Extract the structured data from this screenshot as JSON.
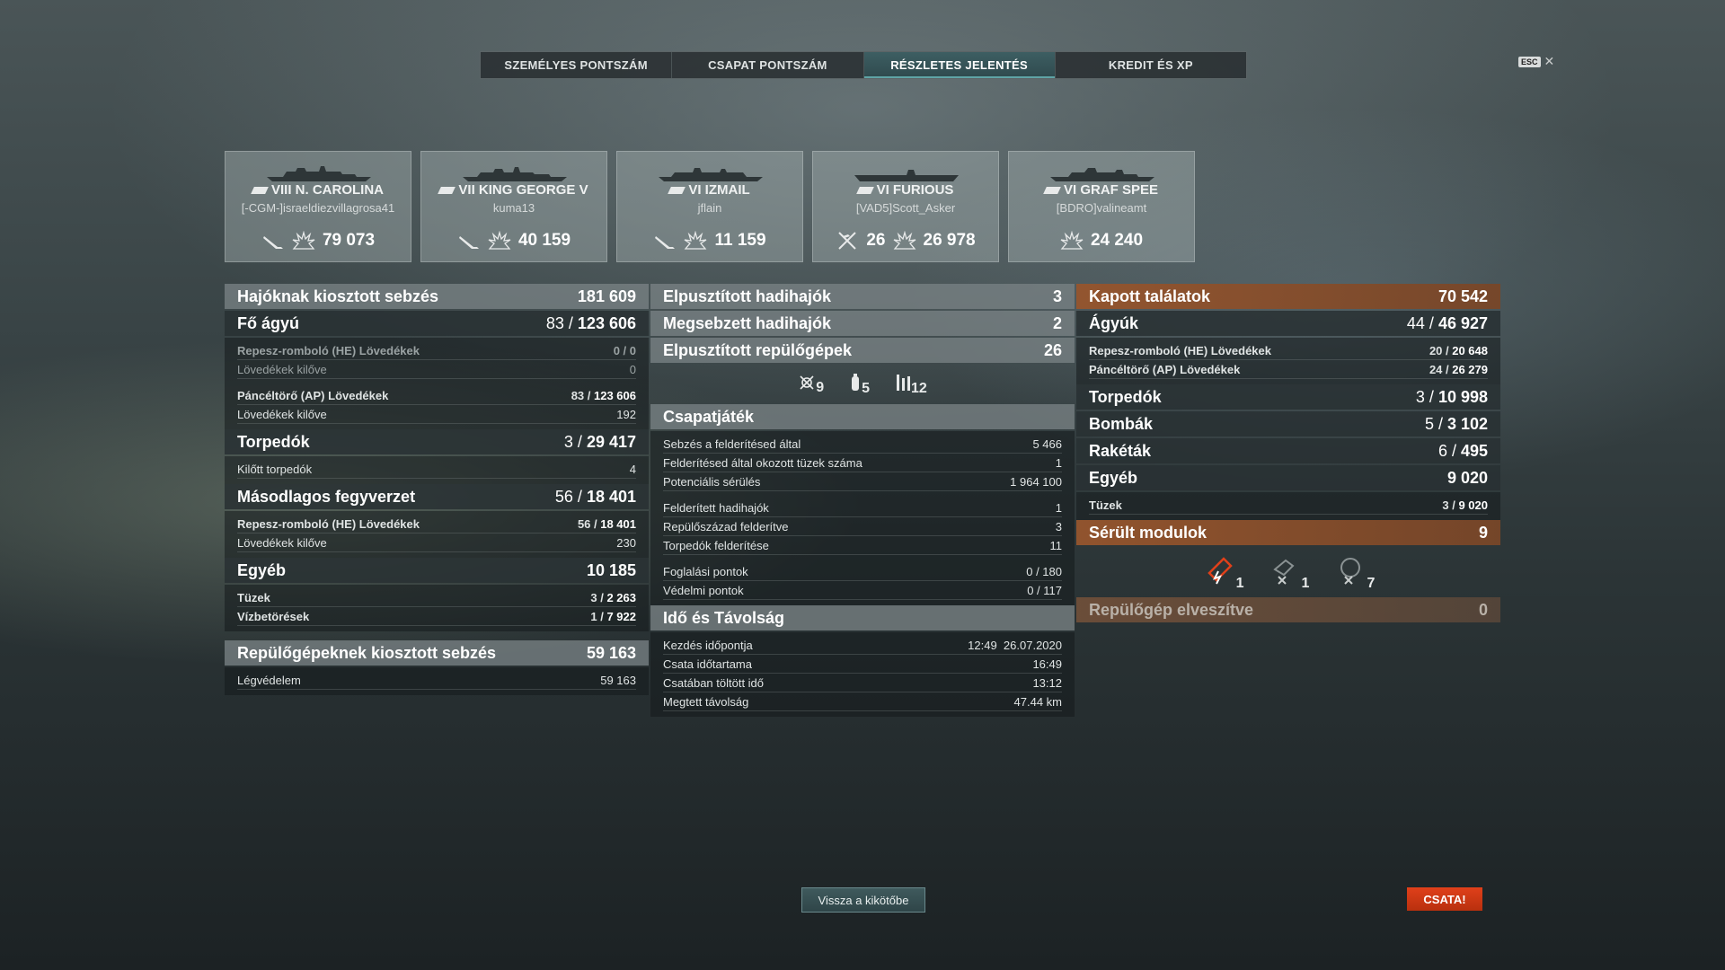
{
  "tabs": [
    "SZEMÉLYES PONTSZÁM",
    "CSAPAT PONTSZÁM",
    "RÉSZLETES JELENTÉS",
    "KREDIT ÉS XP"
  ],
  "esc": {
    "key": "ESC",
    "close": "✕"
  },
  "ships": [
    {
      "name": "VIII N. CAROLINA",
      "player": "[-CGM-]israeldiezvillagrosa41",
      "stats": [
        {
          "icon": "torpedo-hit-icon",
          "value": ""
        },
        {
          "icon": "damage-splash-icon",
          "value": "79 073"
        }
      ]
    },
    {
      "name": "VII KING GEORGE V",
      "player": "kuma13",
      "stats": [
        {
          "icon": "torpedo-hit-icon",
          "value": ""
        },
        {
          "icon": "damage-splash-icon",
          "value": "40 159"
        }
      ]
    },
    {
      "name": "VI IZMAIL",
      "player": "jflain",
      "stats": [
        {
          "icon": "torpedo-hit-icon",
          "value": ""
        },
        {
          "icon": "damage-splash-icon",
          "value": "11 159"
        }
      ]
    },
    {
      "name": "VI FURIOUS",
      "player": "[VAD5]Scott_Asker",
      "stats": [
        {
          "icon": "plane-shot-icon",
          "value": "26"
        },
        {
          "icon": "damage-splash-icon",
          "value": "26 978"
        }
      ]
    },
    {
      "name": "VI GRAF SPEE",
      "player": "[BDRO]valineamt",
      "stats": [
        {
          "icon": "damage-splash-icon",
          "value": "24 240"
        }
      ]
    }
  ],
  "left": {
    "ship_damage": {
      "label": "Hajóknak kiosztott sebzés",
      "value": "181 609"
    },
    "main": {
      "label": "Fő ágyú",
      "hits": "83 / ",
      "dmg": "123 606"
    },
    "he": {
      "label": "Repesz-romboló (HE) Lövedékek",
      "value": "0 / 0"
    },
    "he_fired": {
      "label": "Lövedékek kilőve",
      "value": "0"
    },
    "ap": {
      "label": "Páncéltörő (AP) Lövedékek",
      "hits": "83 / ",
      "dmg": "123 606"
    },
    "ap_fired": {
      "label": "Lövedékek kilőve",
      "value": "192"
    },
    "torp": {
      "label": "Torpedók",
      "hits": "3 / ",
      "dmg": "29 417"
    },
    "torp_fired": {
      "label": "Kilőtt torpedók",
      "value": "4"
    },
    "sec": {
      "label": "Másodlagos fegyverzet",
      "hits": "56 / ",
      "dmg": "18 401"
    },
    "sec_he": {
      "label": "Repesz-romboló (HE) Lövedékek",
      "hits": "56 / ",
      "dmg": "18 401"
    },
    "sec_fired": {
      "label": "Lövedékek kilőve",
      "value": "230"
    },
    "other": {
      "label": "Egyéb",
      "value": "10 185"
    },
    "fires": {
      "label": "Tüzek",
      "hits": "3 / ",
      "dmg": "2 263"
    },
    "flood": {
      "label": "Vízbetörések",
      "hits": "1 / ",
      "dmg": "7 922"
    },
    "plane_damage": {
      "label": "Repülőgépeknek kiosztott sebzés",
      "value": "59 163"
    },
    "aa": {
      "label": "Légvédelem",
      "value": "59 163"
    }
  },
  "mid": {
    "destroyed": {
      "label": "Elpusztított hadihajók",
      "value": "3"
    },
    "damaged": {
      "label": "Megsebzett hadihajók",
      "value": "2"
    },
    "planes": {
      "label": "Elpusztított repülőgépek",
      "value": "26"
    },
    "plane_types": [
      {
        "icon": "fighter-icon",
        "value": "9"
      },
      {
        "icon": "bomber-icon",
        "value": "5"
      },
      {
        "icon": "rocket-plane-icon",
        "value": "12"
      }
    ],
    "team": {
      "label": "Csapatjáték"
    },
    "spot_dmg": {
      "label": "Sebzés a felderítésed által",
      "value": "5 466"
    },
    "spot_fires": {
      "label": "Felderítésed által okozott tüzek száma",
      "value": "1"
    },
    "potential": {
      "label": "Potenciális sérülés",
      "value": "1 964 100"
    },
    "spotted_ships": {
      "label": "Felderített hadihajók",
      "value": "1"
    },
    "spotted_squad": {
      "label": "Repülőszázad felderítve",
      "value": "3"
    },
    "spotted_torp": {
      "label": "Torpedók felderítése",
      "value": "11"
    },
    "capture": {
      "label": "Foglalási pontok",
      "value": "0 / 180"
    },
    "defense": {
      "label": "Védelmi pontok",
      "value": "0 / 117"
    },
    "time": {
      "label": "Idő és Távolság"
    },
    "start": {
      "label": "Kezdés időpontja",
      "value": "12:49  26.07.2020"
    },
    "duration": {
      "label": "Csata időtartama",
      "value": "16:49"
    },
    "alive": {
      "label": "Csatában töltött idő",
      "value": "13:12"
    },
    "distance": {
      "label": "Megtett távolság",
      "value": "47.44 km"
    }
  },
  "right": {
    "received": {
      "label": "Kapott találatok",
      "value": "70 542"
    },
    "guns": {
      "label": "Ágyúk",
      "hits": "44 / ",
      "dmg": "46 927"
    },
    "he": {
      "label": "Repesz-romboló (HE) Lövedékek",
      "hits": "20 / ",
      "dmg": "20 648"
    },
    "ap": {
      "label": "Páncéltörő (AP) Lövedékek",
      "hits": "24 / ",
      "dmg": "26 279"
    },
    "torp": {
      "label": "Torpedók",
      "hits": "3 / ",
      "dmg": "10 998"
    },
    "bombs": {
      "label": "Bombák",
      "hits": "5 / ",
      "dmg": "3 102"
    },
    "rockets": {
      "label": "Rakéták",
      "hits": "6 / ",
      "dmg": "495"
    },
    "other": {
      "label": "Egyéb",
      "value": "9 020"
    },
    "fires": {
      "label": "Tüzek",
      "hits": "3 / ",
      "dmg": "9 020"
    },
    "modules": {
      "label": "Sérült modulok",
      "value": "9"
    },
    "module_types": [
      {
        "icon": "engine-damage-icon",
        "value": "1",
        "color": "#e0401a"
      },
      {
        "icon": "turret-damage-icon",
        "value": "1",
        "color": "#c8cccc"
      },
      {
        "icon": "aa-damage-icon",
        "value": "7",
        "color": "#c8cccc"
      }
    ],
    "plane_lost": {
      "label": "Repülőgép elveszítve",
      "value": "0"
    }
  },
  "buttons": {
    "port": "Vissza a kikötőbe",
    "battle": "CSATA!"
  }
}
